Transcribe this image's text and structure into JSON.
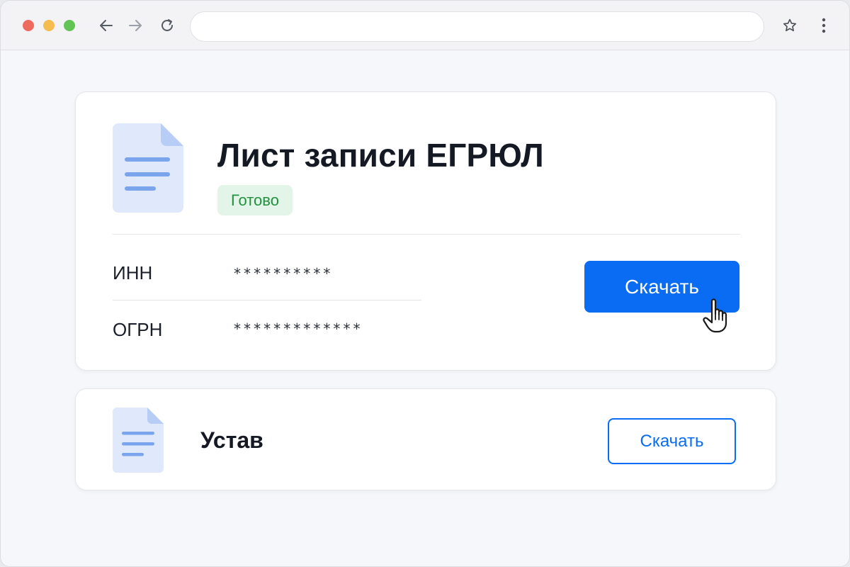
{
  "browser": {
    "address_value": "",
    "icons": [
      "back-arrow-icon",
      "forward-arrow-icon",
      "reload-icon",
      "star-icon",
      "more-vertical-icon"
    ]
  },
  "document_main": {
    "title": "Лист записи ЕГРЮЛ",
    "status": "Готово",
    "fields": [
      {
        "label": "ИНН",
        "value": "**********"
      },
      {
        "label": "ОГРН",
        "value": "*************"
      }
    ],
    "download_label": "Скачать"
  },
  "document_second": {
    "title": "Устав",
    "download_label": "Скачать"
  },
  "colors": {
    "accent": "#0a6cf2",
    "status_bg": "#e3f4e8",
    "status_text": "#23913f",
    "doc_icon": "#dfe9fb",
    "doc_lines": "#7aa4ec"
  }
}
